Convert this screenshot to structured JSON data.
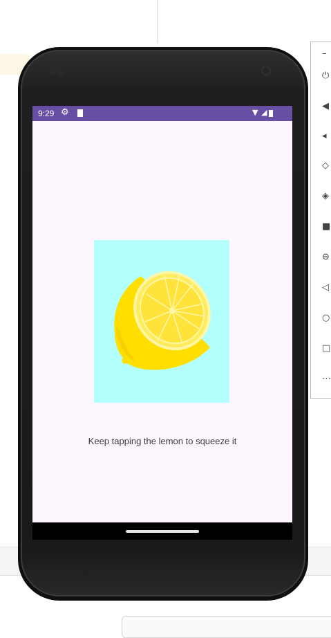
{
  "device": {
    "status_bar": {
      "time": "9:29",
      "settings_icon": "gear-icon",
      "sd_icon": "sd-card-icon",
      "wifi_icon": "wifi-icon",
      "signal_icon": "signal-icon",
      "battery_icon": "battery-icon",
      "color": "#6750a4"
    },
    "app": {
      "background": "#fef7ff",
      "image": {
        "name": "lemon-slice",
        "background": "#b2fffd"
      },
      "instruction_text": "Keep tapping the lemon to squeeze it"
    },
    "nav": {
      "home_indicator": "home-pill"
    }
  },
  "emulator_toolbar": {
    "header": "–",
    "buttons": [
      {
        "icon": "power-icon",
        "glyph": "⏻"
      },
      {
        "icon": "volume-up-icon",
        "glyph": "◀"
      },
      {
        "icon": "volume-down-icon",
        "glyph": "◂"
      },
      {
        "icon": "rotate-left-icon",
        "glyph": "◇"
      },
      {
        "icon": "rotate-right-icon",
        "glyph": "◈"
      },
      {
        "icon": "camera-icon",
        "glyph": "■"
      },
      {
        "icon": "zoom-icon",
        "glyph": "⊖"
      },
      {
        "icon": "back-icon",
        "glyph": "◁"
      },
      {
        "icon": "home-icon",
        "glyph": "○"
      },
      {
        "icon": "overview-icon",
        "glyph": "□"
      },
      {
        "icon": "more-icon",
        "glyph": "⋯"
      }
    ]
  }
}
